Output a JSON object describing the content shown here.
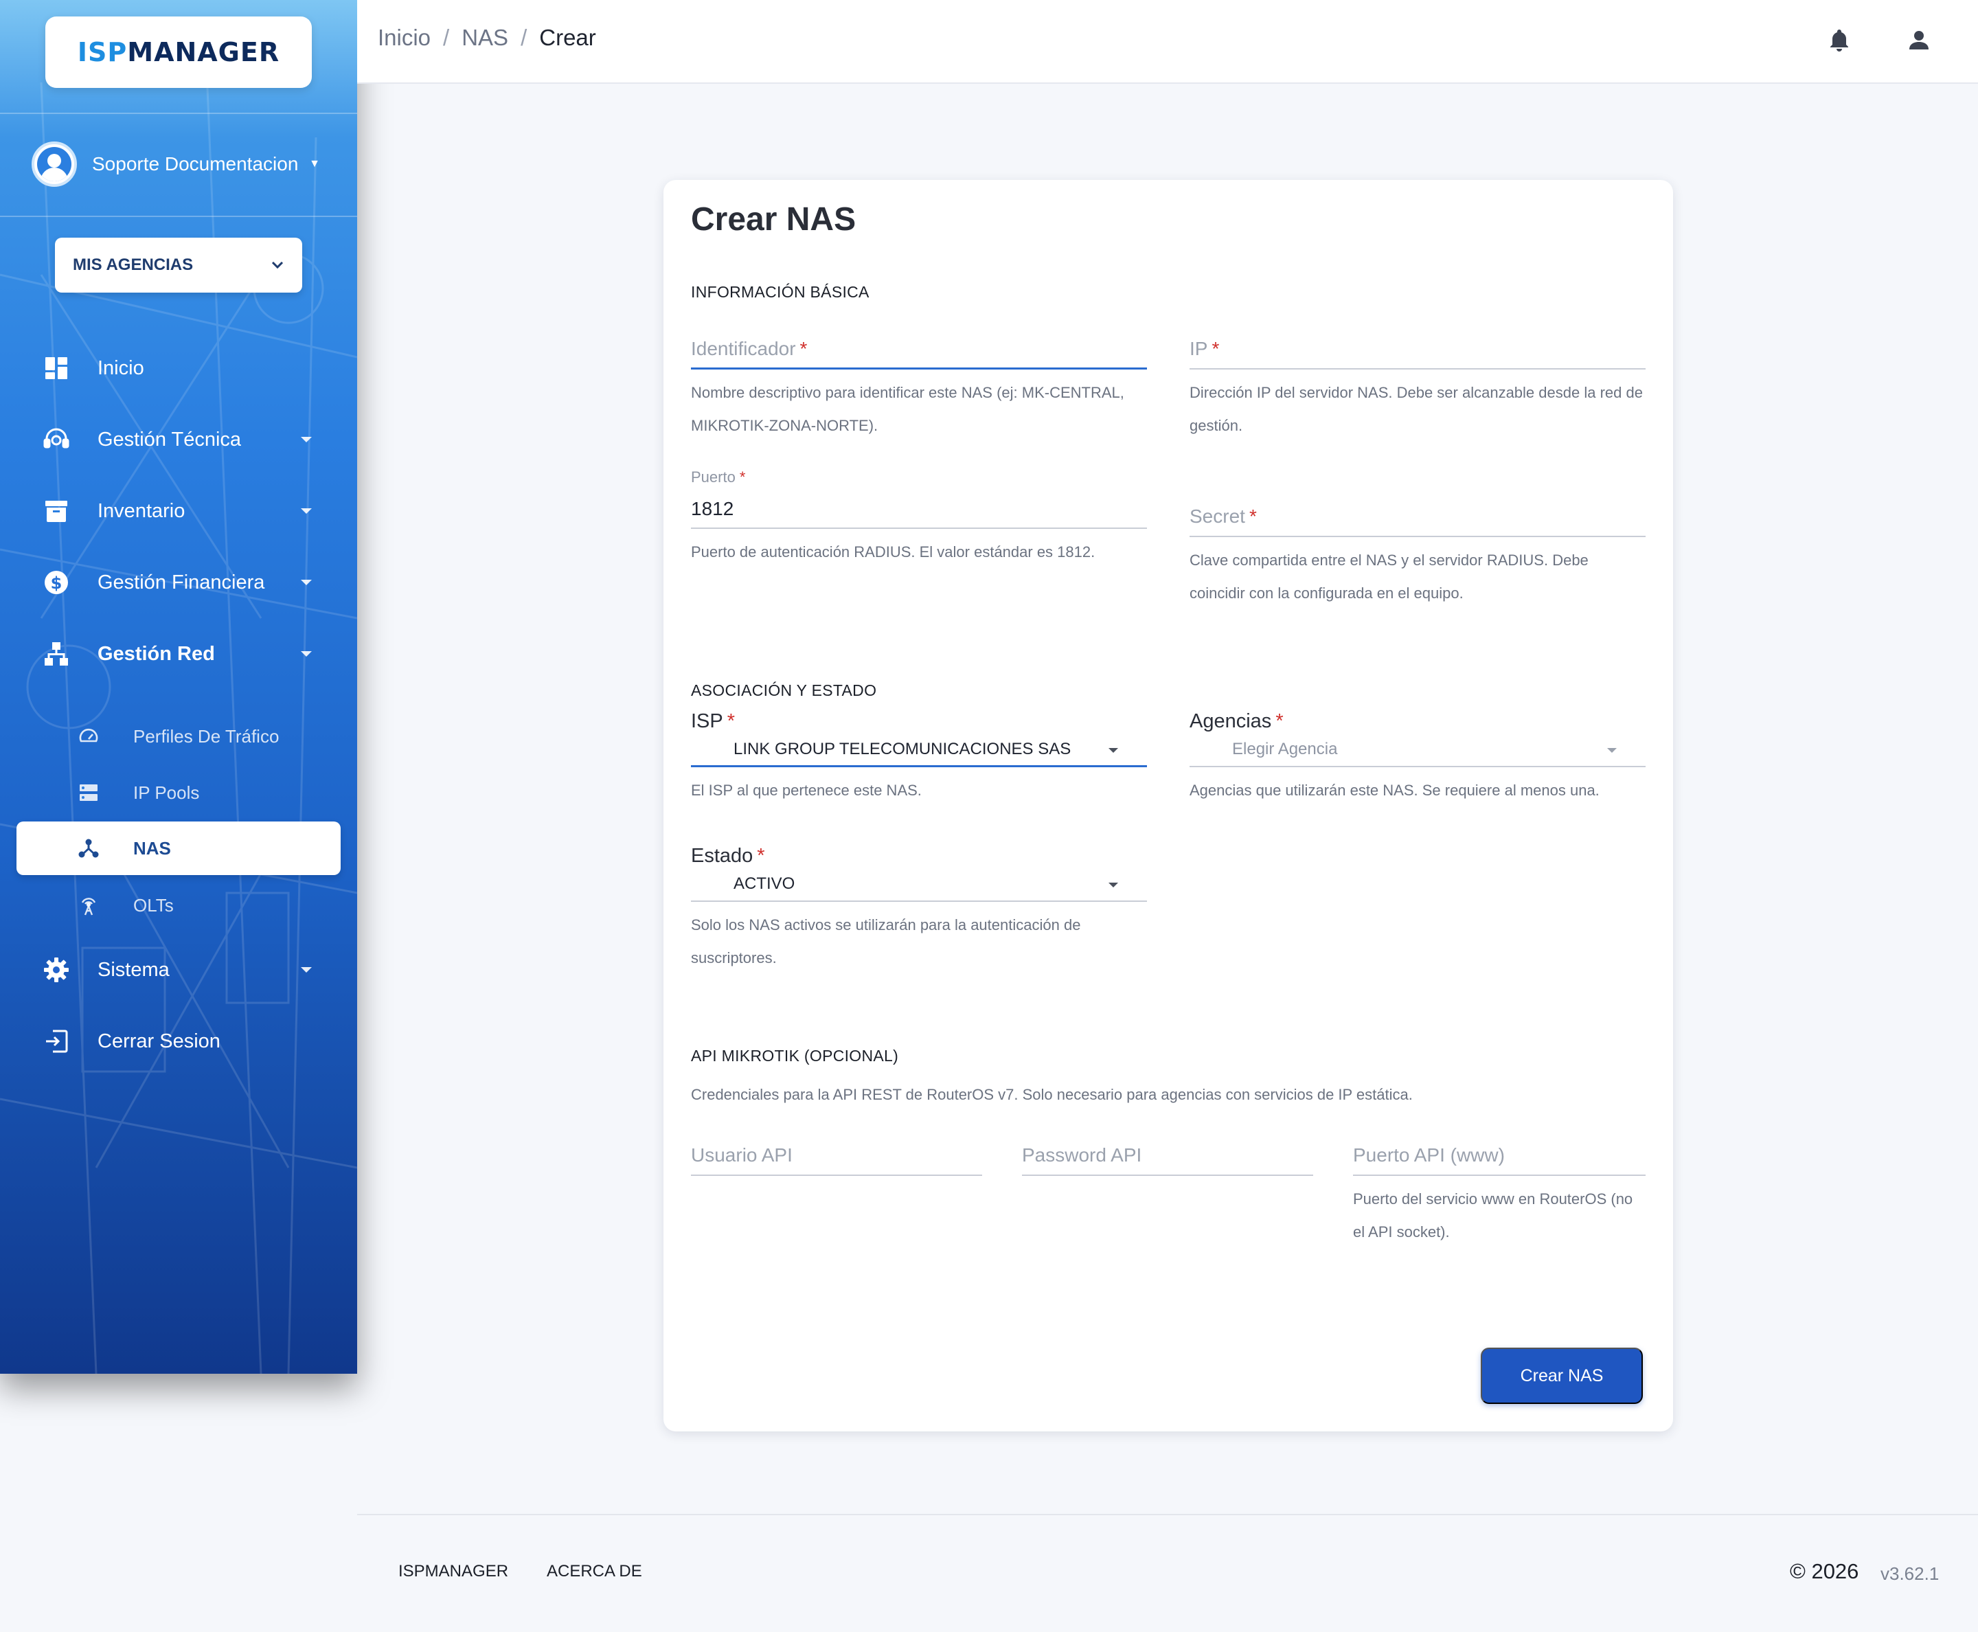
{
  "brand": {
    "part1": "ISP",
    "part2": "MANAGER"
  },
  "sidebar": {
    "user_name": "Soporte Documentacion",
    "agency_selector": "MIS AGENCIAS",
    "items": [
      {
        "label": "Inicio",
        "icon": "dashboard-icon"
      },
      {
        "label": "Gestión Técnica",
        "icon": "support-agent-icon"
      },
      {
        "label": "Inventario",
        "icon": "archive-box-icon"
      },
      {
        "label": "Gestión Financiera",
        "icon": "dollar-circle-icon"
      },
      {
        "label": "Gestión Red",
        "icon": "network-tree-icon"
      },
      {
        "label": "Sistema",
        "icon": "gear-icon"
      },
      {
        "label": "Cerrar Sesion",
        "icon": "logout-icon"
      }
    ],
    "subitems": [
      {
        "label": "Perfiles De Tráfico",
        "icon": "speedometer-icon"
      },
      {
        "label": "IP Pools",
        "icon": "server-icon"
      },
      {
        "label": "NAS",
        "icon": "hub-icon",
        "active": true
      },
      {
        "label": "OLTs",
        "icon": "antenna-icon"
      }
    ]
  },
  "breadcrumb": {
    "home": "Inicio",
    "section": "NAS",
    "current": "Crear",
    "separator": "/"
  },
  "form": {
    "title": "Crear NAS",
    "sections": {
      "basic": "INFORMACIÓN BÁSICA",
      "association": "ASOCIACIÓN Y ESTADO",
      "api": "API MIKROTIK (OPCIONAL)"
    },
    "required_mark": "*",
    "identificador": {
      "placeholder": "Identificador",
      "hint": "Nombre descriptivo para identificar este NAS (ej: MK-CENTRAL, MIKROTIK-ZONA-NORTE)."
    },
    "ip": {
      "placeholder": "IP",
      "hint": "Dirección IP del servidor NAS. Debe ser alcanzable desde la red de gestión."
    },
    "puerto": {
      "label": "Puerto",
      "value": "1812",
      "hint": "Puerto de autenticación RADIUS. El valor estándar es 1812."
    },
    "secret": {
      "placeholder": "Secret",
      "hint": "Clave compartida entre el NAS y el servidor RADIUS. Debe coincidir con la configurada en el equipo."
    },
    "isp": {
      "label": "ISP",
      "value": "LINK GROUP TELECOMUNICACIONES SAS",
      "hint": "El ISP al que pertenece este NAS."
    },
    "agencias": {
      "label": "Agencias",
      "placeholder": "Elegir Agencia",
      "hint": "Agencias que utilizarán este NAS. Se requiere al menos una."
    },
    "estado": {
      "label": "Estado",
      "value": "ACTIVO",
      "hint": "Solo los NAS activos se utilizarán para la autenticación de suscriptores."
    },
    "api_description": "Credenciales para la API REST de RouterOS v7. Solo necesario para agencias con servicios de IP estática.",
    "usuario_api": {
      "placeholder": "Usuario API"
    },
    "password_api": {
      "placeholder": "Password API"
    },
    "puerto_api": {
      "placeholder": "Puerto API (www)",
      "hint": "Puerto del servicio www en RouterOS (no el API socket)."
    },
    "submit": "Crear NAS"
  },
  "footer": {
    "links": [
      "ISPMANAGER",
      "ACERCA DE"
    ],
    "copyright": "© 2026",
    "version": "v3.62.1"
  },
  "colors": {
    "primary": "#1f56c1",
    "focus": "#2a6cd0",
    "required": "#d0312d",
    "sidebar_top": "#7ec6f3",
    "sidebar_bottom": "#10388c"
  }
}
